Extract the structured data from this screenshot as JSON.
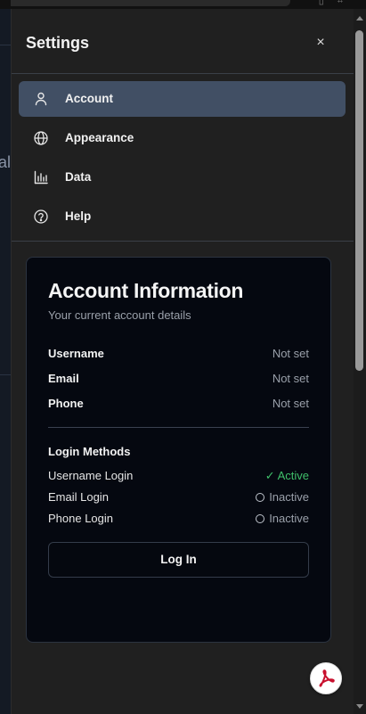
{
  "settings": {
    "title": "Settings",
    "close_icon": "×",
    "nav": [
      {
        "label": "Account",
        "icon": "user-icon",
        "active": true
      },
      {
        "label": "Appearance",
        "icon": "globe-icon",
        "active": false
      },
      {
        "label": "Data",
        "icon": "bar-chart-icon",
        "active": false
      },
      {
        "label": "Help",
        "icon": "help-circle-icon",
        "active": false
      }
    ]
  },
  "account": {
    "title": "Account Information",
    "subtitle": "Your current account details",
    "fields": [
      {
        "label": "Username",
        "value": "Not set"
      },
      {
        "label": "Email",
        "value": "Not set"
      },
      {
        "label": "Phone",
        "value": "Not set"
      }
    ],
    "login_methods_title": "Login Methods",
    "methods": [
      {
        "label": "Username Login",
        "status": "✓ Active"
      },
      {
        "label": "Email Login",
        "status": "Inactive"
      },
      {
        "label": "Phone Login",
        "status": "Inactive"
      }
    ],
    "login_button": "Log In"
  },
  "background": {
    "partial_text": "al"
  },
  "colors": {
    "active_nav": "#414f64",
    "active_status": "#3fbf6a",
    "card_bg": "#050810",
    "pdf_red": "#c8102e"
  }
}
